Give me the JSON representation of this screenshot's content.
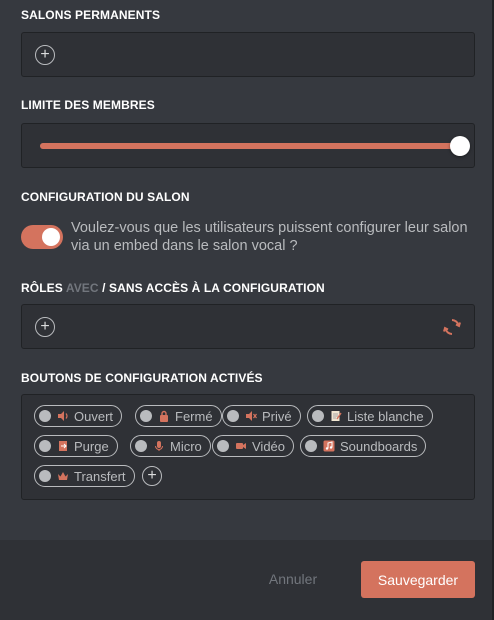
{
  "permanent": {
    "title": "SALONS PERMANENTS"
  },
  "members": {
    "title": "LIMITE DES MEMBRES",
    "value": 1.0
  },
  "config": {
    "title": "CONFIGURATION DU SALON",
    "toggle_on": true,
    "toggle_text": "Voulez-vous que les utilisateurs puissent configurer leur salon via un embed dans le salon vocal ?"
  },
  "roles": {
    "title_prefix": "RÔLES ",
    "title_avec": "AVEC",
    "title_suffix": " / SANS ACCÈS À LA CONFIGURATION"
  },
  "buttons": {
    "title": "BOUTONS DE CONFIGURATION ACTIVÉS",
    "items": [
      {
        "label": "Ouvert",
        "icon": "speaker-icon"
      },
      {
        "label": "Fermé",
        "icon": "lock-icon"
      },
      {
        "label": "Privé",
        "icon": "muted-speaker-icon"
      },
      {
        "label": "Liste blanche",
        "icon": "note-icon"
      },
      {
        "label": "Purge",
        "icon": "exit-door-icon"
      },
      {
        "label": "Micro",
        "icon": "microphone-icon"
      },
      {
        "label": "Vidéo",
        "icon": "camera-icon"
      },
      {
        "label": "Soundboards",
        "icon": "music-icon"
      },
      {
        "label": "Transfert",
        "icon": "crown-icon"
      }
    ]
  },
  "footer": {
    "cancel": "Annuler",
    "save": "Sauvegarder"
  },
  "colors": {
    "accent": "#d4735e",
    "background": "#36393f",
    "box": "#2f3136"
  }
}
